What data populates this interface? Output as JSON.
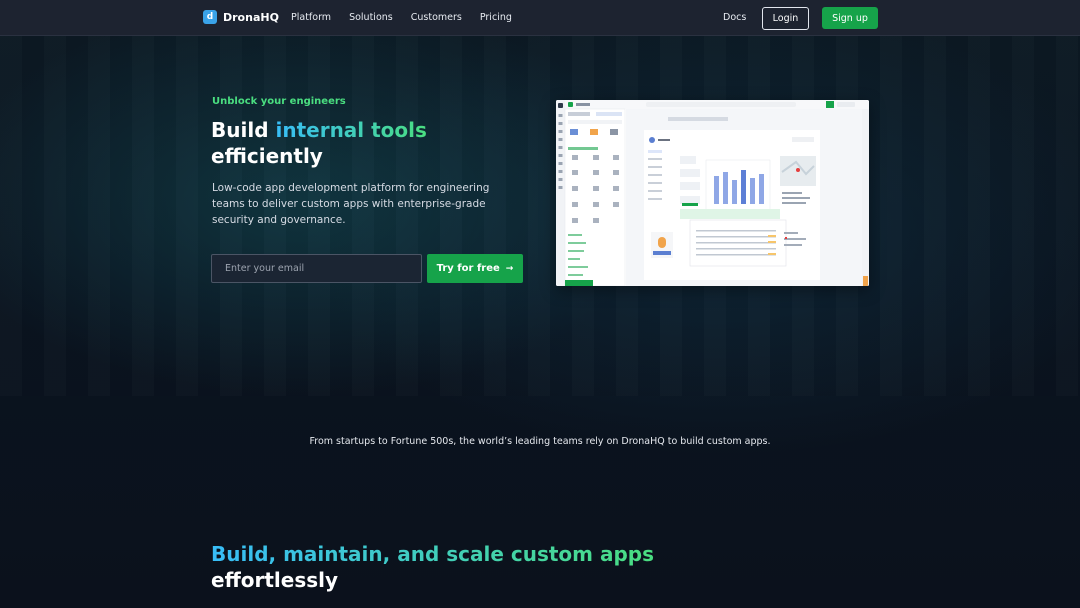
{
  "nav": {
    "logo_mark": "d",
    "logo_text": "DronaHQ",
    "links": [
      "Platform",
      "Solutions",
      "Customers",
      "Pricing"
    ],
    "docs": "Docs",
    "login": "Login",
    "signup": "Sign up"
  },
  "hero": {
    "eyebrow": "Unblock your engineers",
    "title_prefix": "Build ",
    "title_highlight": "internal tools",
    "title_suffix": "efficiently",
    "description": "Low-code app development platform for engineering teams to deliver custom apps with enterprise-grade security and governance.",
    "email_placeholder": "Enter your email",
    "cta": "Try for free",
    "cta_icon": "arrow-right-icon"
  },
  "tagline": "From startups to Fortune 500s, the world’s leading teams rely on DronaHQ to build custom apps.",
  "section": {
    "title_highlight": "Build, maintain, and scale custom apps",
    "title_suffix": "effortlessly"
  },
  "colors": {
    "accent_green": "#16a34a",
    "eyebrow_green": "#4ade80",
    "gradient_blue": "#38bdf8",
    "nav_bg": "#1d2330",
    "logo_blue": "#3aa3e8"
  }
}
